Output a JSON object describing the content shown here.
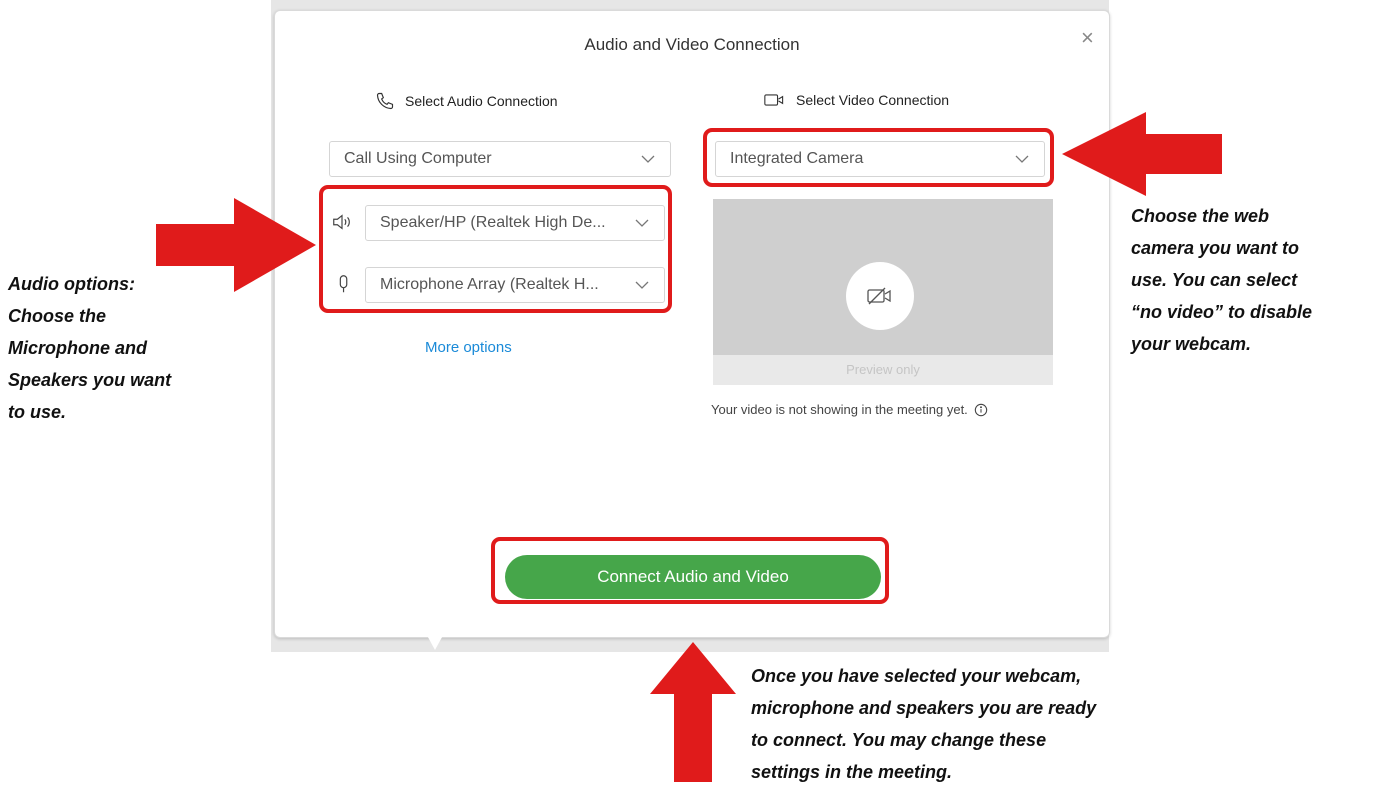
{
  "dialog": {
    "title": "Audio and Video Connection",
    "close_glyph": "×",
    "audio": {
      "heading": "Select Audio Connection",
      "connection": "Call Using Computer",
      "speaker": "Speaker/HP (Realtek High De...",
      "microphone": "Microphone Array (Realtek H...",
      "more_options": "More options"
    },
    "video": {
      "heading": "Select Video Connection",
      "camera": "Integrated Camera",
      "preview_label": "Preview only",
      "notice": "Your video is not showing in the meeting yet."
    },
    "connect_label": "Connect Audio and Video"
  },
  "annotations": {
    "audio": [
      "Audio options:",
      "Choose the",
      "Microphone and",
      "Speakers you want",
      "to use."
    ],
    "video": [
      "Choose the web",
      "camera you want to",
      "use. You can select",
      "“no video” to disable",
      "your webcam."
    ],
    "connect": [
      "Once you have selected your webcam,",
      "microphone and speakers you are ready",
      "to connect. You may change these",
      "settings in the meeting."
    ]
  },
  "colors": {
    "highlight": "#e01b1b",
    "connect_button": "#46a64a",
    "link": "#1a8ad8"
  },
  "icons": [
    "phone-icon",
    "video-camera-icon",
    "speaker-icon",
    "microphone-icon",
    "camera-off-icon",
    "info-icon",
    "chevron-down-icon",
    "close-icon"
  ]
}
